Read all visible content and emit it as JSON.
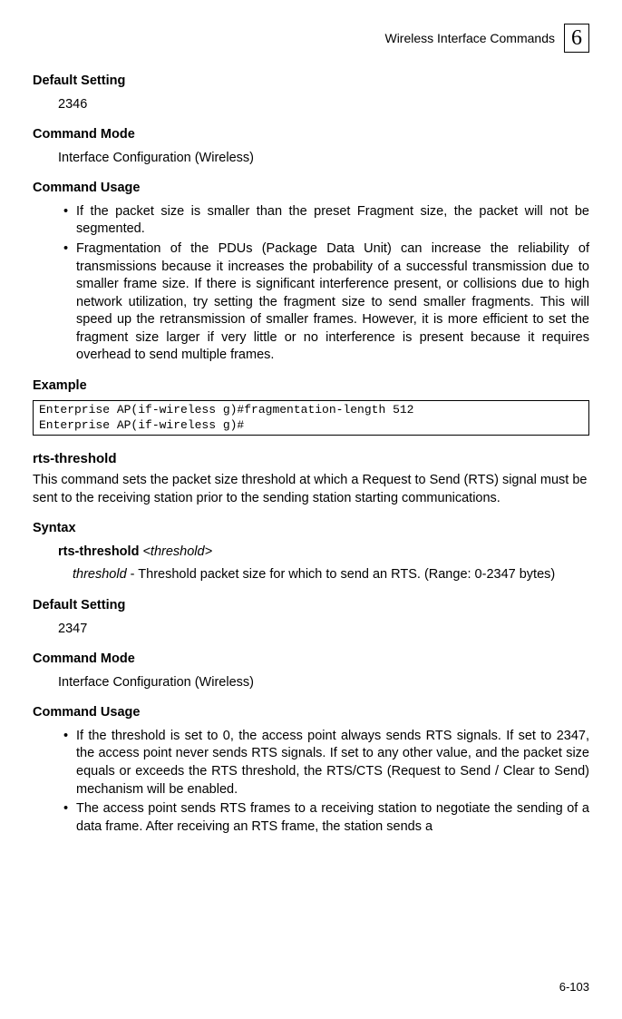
{
  "header": {
    "title": "Wireless Interface Commands",
    "chapter": "6"
  },
  "section1": {
    "defaultSetting": {
      "heading": "Default Setting",
      "value": "2346"
    },
    "commandMode": {
      "heading": "Command Mode",
      "value": "Interface Configuration (Wireless)"
    },
    "commandUsage": {
      "heading": "Command Usage",
      "bullets": [
        "If the packet size is smaller than the preset Fragment size, the packet will not be segmented.",
        "Fragmentation of the PDUs (Package Data Unit) can increase the reliability of transmissions because it increases the probability of a successful transmission due to smaller frame size. If there is significant interference present, or collisions due to high network utilization, try setting the fragment size to send smaller fragments. This will speed up the retransmission of smaller frames. However, it is more efficient to set the fragment size larger if very little or no interference is present because it requires overhead to send multiple frames."
      ]
    },
    "example": {
      "heading": "Example",
      "code": "Enterprise AP(if-wireless g)#fragmentation-length 512\nEnterprise AP(if-wireless g)#"
    }
  },
  "section2": {
    "title": "rts-threshold",
    "description": "This command sets the packet size threshold at which a Request to Send (RTS) signal must be sent to the receiving station prior to the sending station starting communications.",
    "syntax": {
      "heading": "Syntax",
      "command": "rts-threshold",
      "arg": "<threshold>",
      "paramName": "threshold",
      "paramDesc": " - Threshold packet size for which to send an RTS. (Range: 0-2347 bytes)"
    },
    "defaultSetting": {
      "heading": "Default Setting",
      "value": "2347"
    },
    "commandMode": {
      "heading": "Command Mode",
      "value": "Interface Configuration (Wireless)"
    },
    "commandUsage": {
      "heading": "Command Usage",
      "bullets": [
        "If the threshold is set to 0, the access point always sends RTS signals. If set to 2347, the access point never sends RTS signals. If set to any other value, and the packet size equals or exceeds the RTS threshold, the RTS/CTS (Request to Send / Clear to Send) mechanism will be enabled.",
        "The access point sends RTS frames to a receiving station to negotiate the sending of a data frame. After receiving an RTS frame, the station sends a"
      ]
    }
  },
  "footer": {
    "pageNumber": "6-103"
  }
}
